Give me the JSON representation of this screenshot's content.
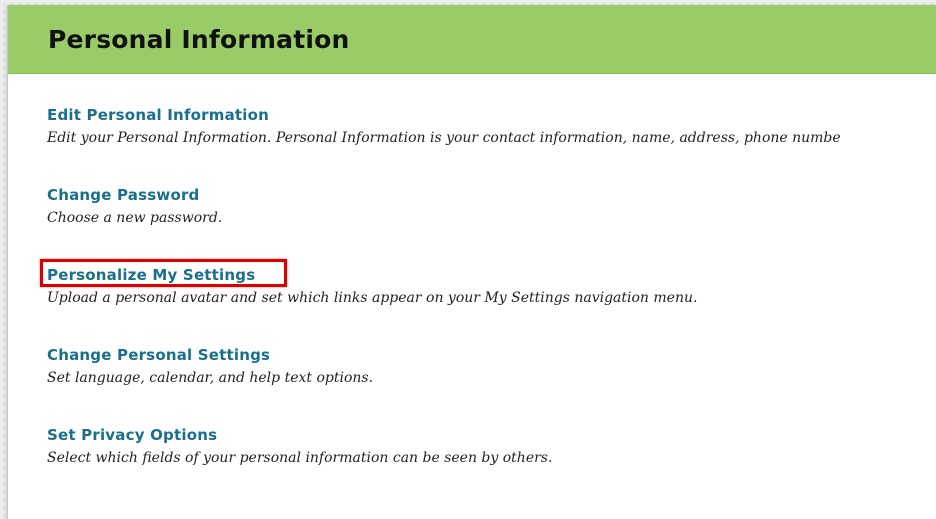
{
  "page": {
    "title": "Personal Information"
  },
  "options": [
    {
      "label": "Edit Personal Information",
      "description": "Edit your Personal Information. Personal Information is your contact information, name, address, phone numbe"
    },
    {
      "label": "Change Password",
      "description": "Choose a new password."
    },
    {
      "label": "Personalize My Settings",
      "description": "Upload a personal avatar and set which links appear on your My Settings navigation menu."
    },
    {
      "label": "Change Personal Settings",
      "description": "Set language, calendar, and help text options."
    },
    {
      "label": "Set Privacy Options",
      "description": "Select which fields of your personal information can be seen by others."
    }
  ],
  "colors": {
    "header_bg": "#99cc66",
    "link": "#1a6f8c",
    "highlight_box": "#dd0000"
  }
}
